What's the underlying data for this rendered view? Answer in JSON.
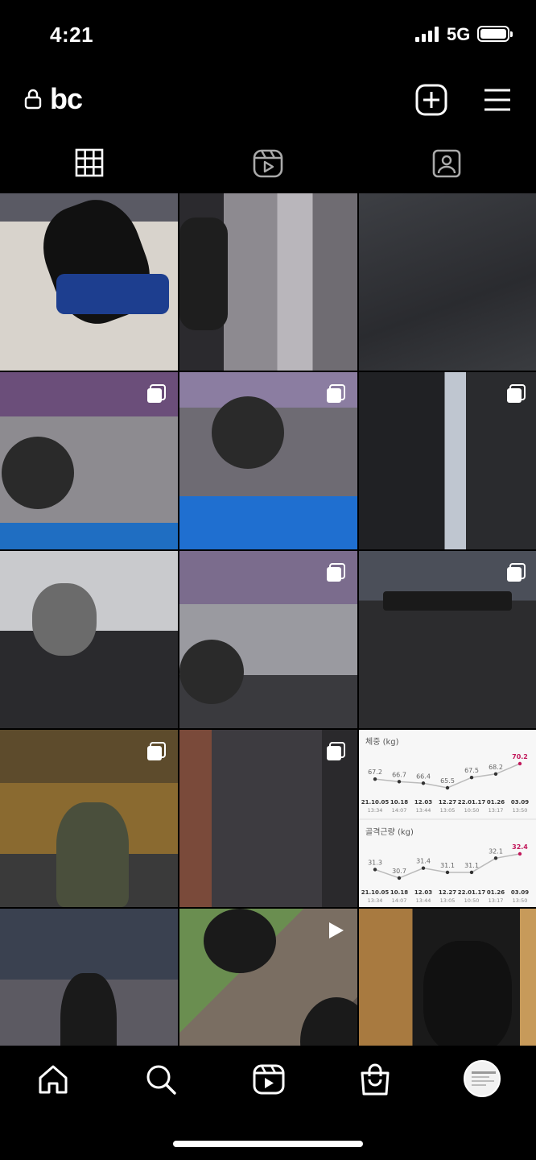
{
  "status_bar": {
    "time": "4:21",
    "network": "5G"
  },
  "header": {
    "username": "bc"
  },
  "tabs": [
    {
      "icon": "grid-icon",
      "active": true
    },
    {
      "icon": "reels-icon",
      "active": false
    },
    {
      "icon": "tagged-icon",
      "active": false
    }
  ],
  "grid": {
    "posts": [
      {
        "type": "photo"
      },
      {
        "type": "photo"
      },
      {
        "type": "photo"
      },
      {
        "type": "carousel"
      },
      {
        "type": "carousel"
      },
      {
        "type": "carousel"
      },
      {
        "type": "photo"
      },
      {
        "type": "carousel"
      },
      {
        "type": "carousel"
      },
      {
        "type": "carousel"
      },
      {
        "type": "carousel"
      },
      {
        "type": "chart"
      },
      {
        "type": "photo"
      },
      {
        "type": "reel"
      },
      {
        "type": "photo"
      }
    ]
  },
  "chart_data": [
    {
      "type": "line",
      "title": "체중 (kg)",
      "categories": [
        "21.10.05",
        "10.18",
        "12.03",
        "12.27",
        "22.01.17",
        "01.26",
        "03.09"
      ],
      "times": [
        "13:34",
        "14:07",
        "13:44",
        "13:05",
        "10:50",
        "13:17",
        "13:50"
      ],
      "values": [
        67.2,
        66.7,
        66.4,
        65.5,
        67.5,
        68.2,
        70.2
      ],
      "highlight_color": "#c2185b"
    },
    {
      "type": "line",
      "title": "골격근량 (kg)",
      "categories": [
        "21.10.05",
        "10.18",
        "12.03",
        "12.27",
        "22.01.17",
        "01.26",
        "03.09"
      ],
      "times": [
        "13:34",
        "14:07",
        "13:44",
        "13:05",
        "10:50",
        "13:17",
        "13:50"
      ],
      "values": [
        31.3,
        30.7,
        31.4,
        31.1,
        31.1,
        32.1,
        32.4
      ],
      "highlight_color": "#c2185b"
    }
  ],
  "bottom_nav": [
    {
      "icon": "home-icon"
    },
    {
      "icon": "search-icon"
    },
    {
      "icon": "reels-icon"
    },
    {
      "icon": "shop-icon"
    },
    {
      "icon": "profile-avatar"
    }
  ]
}
